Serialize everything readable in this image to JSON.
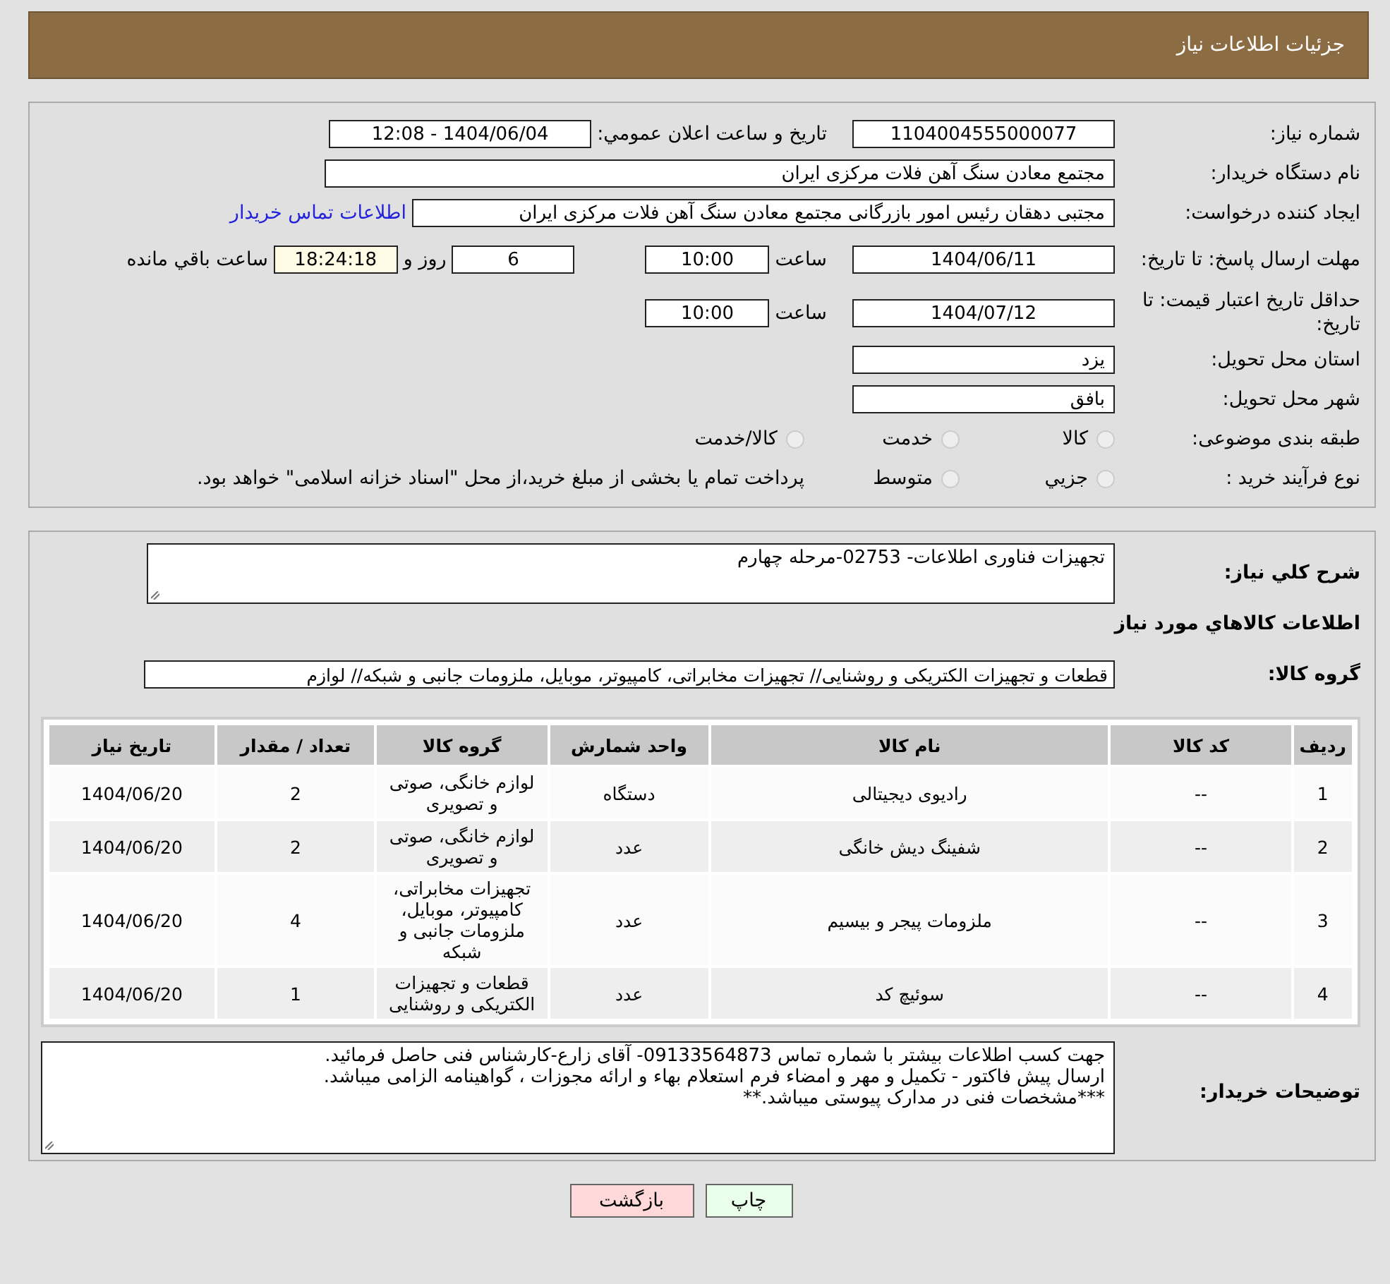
{
  "header": {
    "title": "جزئیات اطلاعات نیاز"
  },
  "need_number": {
    "label": "شماره نياز:",
    "value": "1104004555000077"
  },
  "announce": {
    "label": "تاريخ و ساعت اعلان عمومي:",
    "value": "1404/06/04 - 12:08"
  },
  "buyer": {
    "label": "نام دستگاه خريدار:",
    "value": "مجتمع معادن سنگ آهن فلات مرکزی ایران"
  },
  "creator": {
    "label": "ایجاد کننده درخواست:",
    "value": "مجتبی  دهقان رئیس امور بازرگانی مجتمع معادن سنگ آهن فلات مرکزی ایران",
    "link": "اطلاعات تماس خريدار"
  },
  "deadline": {
    "label": "مهلت ارسال پاسخ: تا تاریخ:",
    "date": "1404/06/11",
    "time_label": "ساعت",
    "time": "10:00",
    "days": "6",
    "days_label": "روز و",
    "remaining": "18:24:18",
    "remaining_label": "ساعت باقي مانده"
  },
  "validity": {
    "label": "حداقل تاريخ اعتبار قيمت: تا تاریخ:",
    "date": "1404/07/12",
    "time_label": "ساعت",
    "time": "10:00"
  },
  "province": {
    "label": "استان محل تحويل:",
    "value": "یزد"
  },
  "city": {
    "label": "شهر محل تحويل:",
    "value": "بافق"
  },
  "category": {
    "label": "طبقه بندی موضوعی:",
    "options": [
      {
        "label": "کالا",
        "selected": false
      },
      {
        "label": "خدمت",
        "selected": false
      },
      {
        "label": "کالا/خدمت",
        "selected": false
      }
    ]
  },
  "process": {
    "label": "نوع فرآيند خريد :",
    "options": [
      {
        "label": "جزيي",
        "selected": false
      },
      {
        "label": "متوسط",
        "selected": false
      }
    ],
    "note": "پرداخت تمام يا بخشی از مبلغ خريد،از محل \"اسناد خزانه اسلامی\" خواهد بود."
  },
  "summary": {
    "label": "شرح کلي نياز:",
    "value": "تجهیزات فناوری اطلاعات- 02753-مرحله چهارم"
  },
  "goods_heading": "اطلاعات کالاهاي مورد نياز",
  "goods_group": {
    "label": "گروه کالا:",
    "value": "قطعات و تجهیزات الکتریکی و روشنایی// تجهیزات مخابراتی، کامپیوتر، موبایل، ملزومات جانبی و شبکه// لوازم"
  },
  "table": {
    "columns": [
      "رديف",
      "کد کالا",
      "نام کالا",
      "واحد شمارش",
      "گروه کالا",
      "تعداد / مقدار",
      "تاريخ نياز"
    ],
    "rows": [
      [
        "1",
        "--",
        "رادیوی دیجیتالی",
        "دستگاه",
        "لوازم خانگی، صوتی و تصویری",
        "2",
        "1404/06/20"
      ],
      [
        "2",
        "--",
        "شفینگ دیش خانگی",
        "عدد",
        "لوازم خانگی، صوتی و تصویری",
        "2",
        "1404/06/20"
      ],
      [
        "3",
        "--",
        "ملزومات پیجر و بیسیم",
        "عدد",
        "تجهیزات مخابراتی، کامپیوتر، موبایل، ملزومات جانبی و شبکه",
        "4",
        "1404/06/20"
      ],
      [
        "4",
        "--",
        "سوئیچ کد",
        "عدد",
        "قطعات و تجهیزات الکتریکی و روشنایی",
        "1",
        "1404/06/20"
      ]
    ]
  },
  "notes": {
    "label": "توضيحات خريدار:",
    "lines": [
      "جهت کسب اطلاعات بیشتر با شماره تماس 09133564873- آقای زارع-کارشناس فنی حاصل فرمائید.",
      "ارسال پیش فاکتور - تکمیل و مهر و امضاء فرم استعلام بهاء و ارائه مجوزات ، گواهینامه  الزامی میباشد.",
      "***مشخصات فنی در مدارک پیوستی میباشد.**"
    ]
  },
  "buttons": [
    {
      "label": "چاپ",
      "kind": "print"
    },
    {
      "label": "بازگشت",
      "kind": "back"
    }
  ]
}
